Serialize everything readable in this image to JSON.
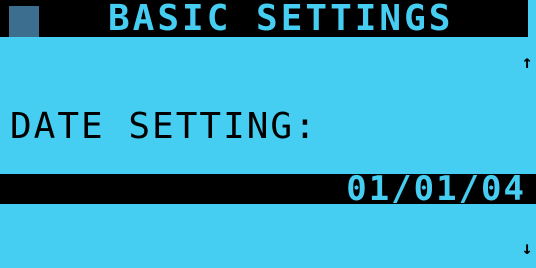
{
  "header": {
    "title": "BASIC SETTINGS"
  },
  "icons": {
    "scroll_up": "↑",
    "scroll_down": "↓"
  },
  "field": {
    "label": "DATE SETTING:",
    "value": "01/01/04"
  },
  "colors": {
    "screen_background": "#45CDF2",
    "bar_background": "#000000",
    "cursor_block": "#3B6E8F"
  }
}
